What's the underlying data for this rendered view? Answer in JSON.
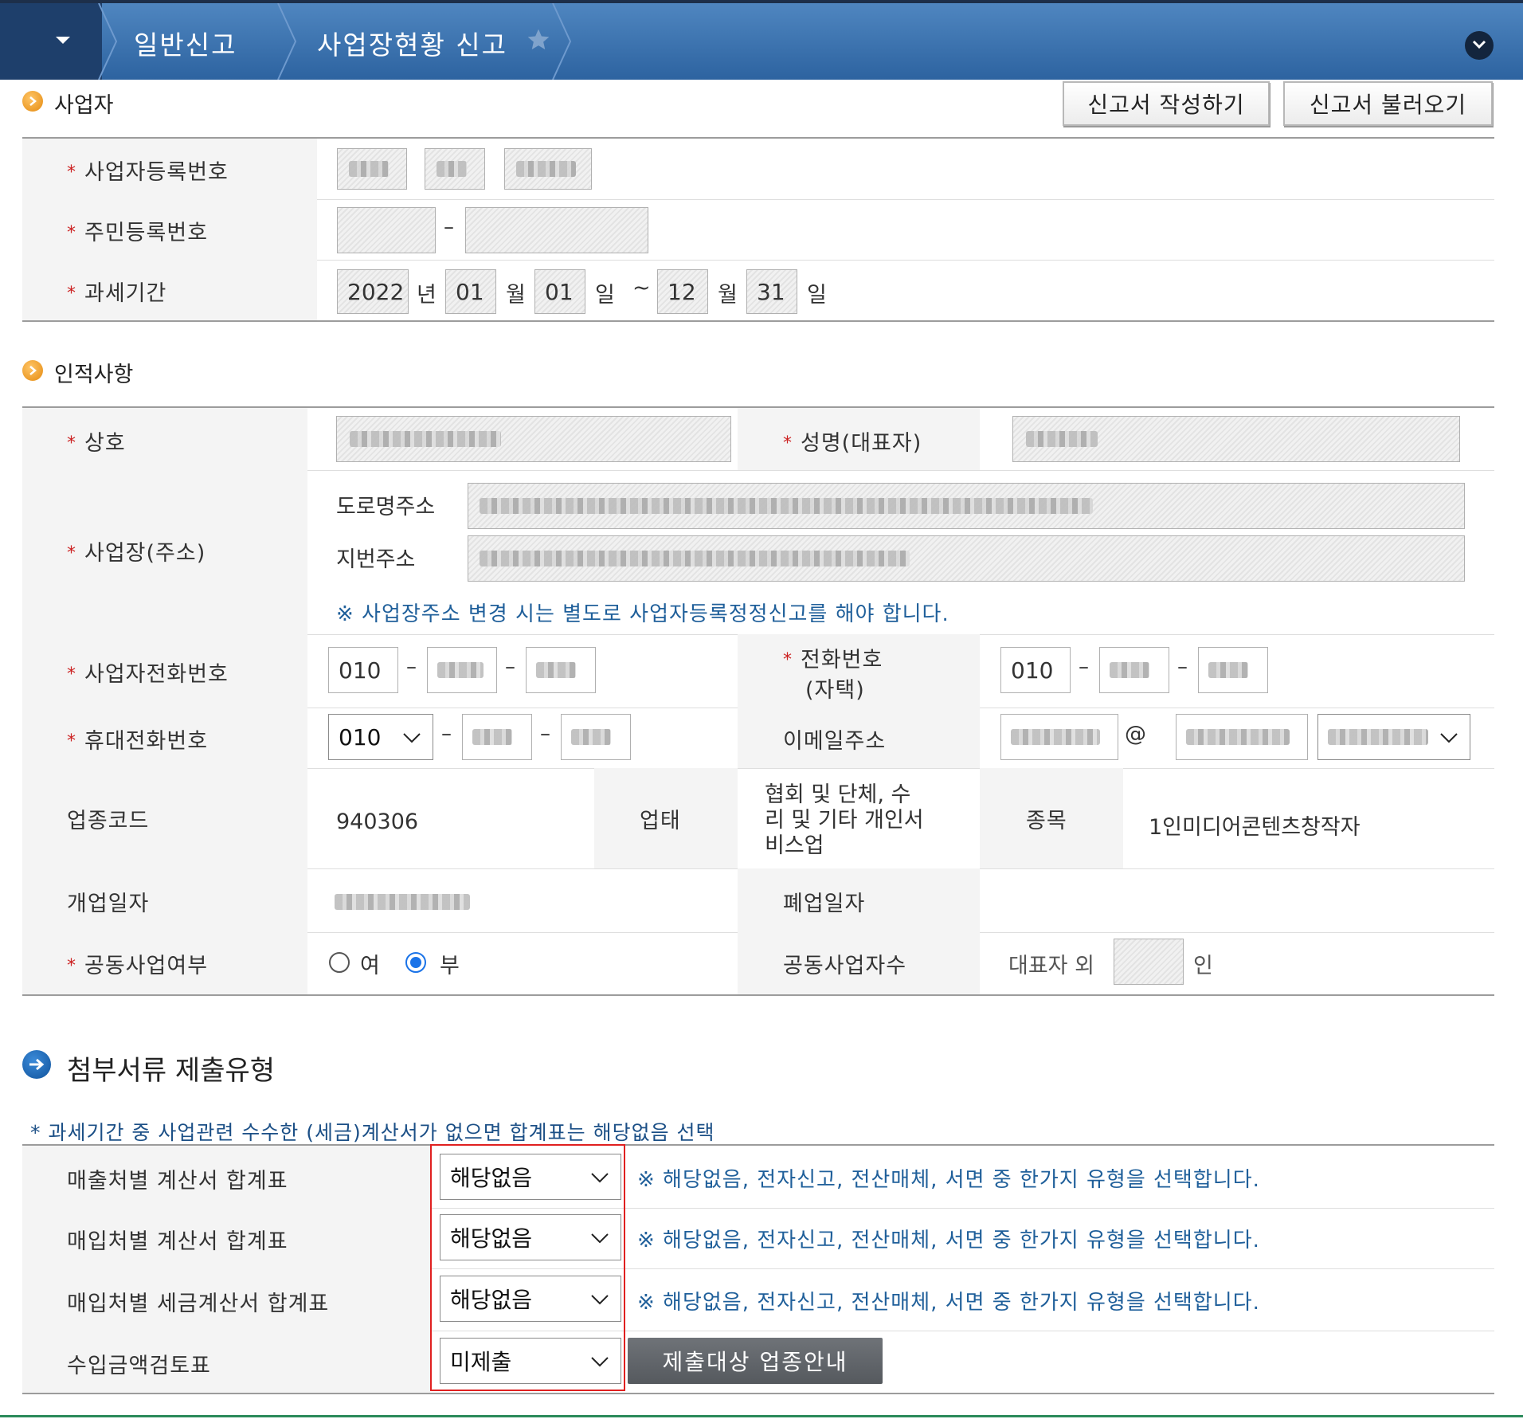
{
  "header": {
    "menu_icon": "caret-down-icon",
    "breadcrumb": [
      "일반신고",
      "사업장현황 신고"
    ],
    "favorite_icon": "star-icon",
    "collapse_icon": "chevron-down-icon"
  },
  "business_section": {
    "title": "사업자",
    "buttons": {
      "write": "신고서 작성하기",
      "load": "신고서 불러오기"
    },
    "rows": {
      "biz_reg_no": {
        "label": "사업자등록번호"
      },
      "resident_no": {
        "label": "주민등록번호",
        "sep": "–"
      },
      "tax_period": {
        "label": "과세기간",
        "from_year": "2022",
        "year_unit": "년",
        "from_month": "01",
        "month_unit": "월",
        "from_day": "01",
        "day_unit": "일",
        "tilde": "~",
        "to_month": "12",
        "to_day": "31"
      }
    }
  },
  "personal_section": {
    "title": "인적사항",
    "trade_name": {
      "label": "상호"
    },
    "representative": {
      "label": "성명(대표자)"
    },
    "address": {
      "label": "사업장(주소)",
      "road_label": "도로명주소",
      "lot_label": "지번주소",
      "note": "※ 사업장주소 변경 시는 별도로 사업자등록정정신고를 해야 합니다."
    },
    "biz_phone": {
      "label": "사업자전화번호",
      "area": "010",
      "sep": "–"
    },
    "home_phone": {
      "label_line1": "전화번호",
      "label_line2": "(자택)",
      "area": "010",
      "sep": "–"
    },
    "mobile": {
      "label": "휴대전화번호",
      "prefix": "010",
      "sep": "–"
    },
    "email": {
      "label": "이메일주소",
      "at": "@"
    },
    "industry_code": {
      "label": "업종코드",
      "value": "940306"
    },
    "business_type": {
      "label": "업태",
      "value_lines": [
        "협회 및 단체, 수",
        "리 및 기타 개인서",
        "비스업"
      ]
    },
    "item": {
      "label": "종목",
      "value": "1인미디어콘텐츠창작자"
    },
    "open_date": {
      "label": "개업일자"
    },
    "close_date": {
      "label": "폐업일자"
    },
    "joint_business": {
      "label": "공동사업여부",
      "yes": "여",
      "no": "부",
      "selected": "부"
    },
    "joint_count": {
      "label": "공동사업자수",
      "prefix": "대표자 외",
      "suffix": "인"
    }
  },
  "attachment_section": {
    "title": "첨부서류 제출유형",
    "note": "* 과세기간 중 사업관련 수수한 (세금)계산서가 없으면 합계표는 해당없음 선택",
    "rows": [
      {
        "label": "매출처별 계산서 합계표",
        "selected": "해당없음",
        "help": "※ 해당없음, 전자신고, 전산매체, 서면 중 한가지 유형을 선택합니다."
      },
      {
        "label": "매입처별 계산서 합계표",
        "selected": "해당없음",
        "help": "※ 해당없음, 전자신고, 전산매체, 서면 중 한가지 유형을 선택합니다."
      },
      {
        "label": "매입처별 세금계산서 합계표",
        "selected": "해당없음",
        "help": "※ 해당없음, 전자신고, 전산매체, 서면 중 한가지 유형을 선택합니다."
      },
      {
        "label": "수입금액검토표",
        "selected": "미제출",
        "button": "제출대상 업종안내"
      }
    ]
  },
  "colors": {
    "header_blue": "#3a72b0",
    "highlight_red": "#e02020",
    "note_blue": "#1f5f9a"
  }
}
